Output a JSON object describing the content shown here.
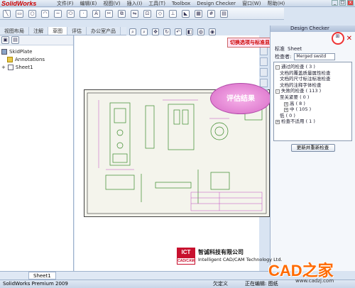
{
  "app": {
    "logo": "SolidWorks",
    "menu": [
      "文件(F)",
      "编辑(E)",
      "视图(V)",
      "插入(I)",
      "工具(T)",
      "Toolbox",
      "Design Checker",
      "窗口(W)",
      "帮助(H)"
    ]
  },
  "left_tabs": [
    "视图布局",
    "注解",
    "草图",
    "评估",
    "办公室产品"
  ],
  "feature_tree": {
    "root": "SkidPlate",
    "items": [
      {
        "label": "Annotations"
      },
      {
        "label": "Sheet1"
      }
    ]
  },
  "callout": "评估结果",
  "tip_label": "切换选项与标准显示",
  "design_checker": {
    "title": "Design Checker",
    "standard_label": "标准",
    "sheet_label": "Sheet",
    "checker_label": "检查者:",
    "checker_value": "Merged swstd",
    "results": [
      {
        "text": "通过的检查 ( 3 )",
        "level": 0,
        "sign": "-"
      },
      {
        "text": "文档的覆盖质量属性检查",
        "level": 1,
        "sign": ""
      },
      {
        "text": "文档的尺寸标注标准检查",
        "level": 1,
        "sign": ""
      },
      {
        "text": "文档的注释字体检查",
        "level": 1,
        "sign": ""
      },
      {
        "text": "失败的检查 ( 113 )",
        "level": 0,
        "sign": "-"
      },
      {
        "text": "至关紧要 ( 0 )",
        "level": 1,
        "sign": ""
      },
      {
        "text": "高 ( 8 )",
        "level": 2,
        "sign": "+"
      },
      {
        "text": "中 ( 105 )",
        "level": 2,
        "sign": "+"
      },
      {
        "text": "低 ( 0 )",
        "level": 1,
        "sign": ""
      },
      {
        "text": "检查不适用 ( 1 )",
        "level": 0,
        "sign": "+"
      }
    ],
    "rerun_button": "更新并重新检查"
  },
  "sheet_tab": "Sheet1",
  "status": {
    "left": "SolidWorks Premium 2009",
    "mid": "欠定义",
    "right": "正在编辑: 图纸"
  },
  "logo": {
    "mark": "ICT",
    "mark_sub": "CAD/CAM",
    "cn": "智诚科技有限公司",
    "en": "Intelligent CAD/CAM Technology Ltd."
  },
  "watermark": {
    "text": "CAD之家",
    "url": "www.cadzj.com"
  }
}
